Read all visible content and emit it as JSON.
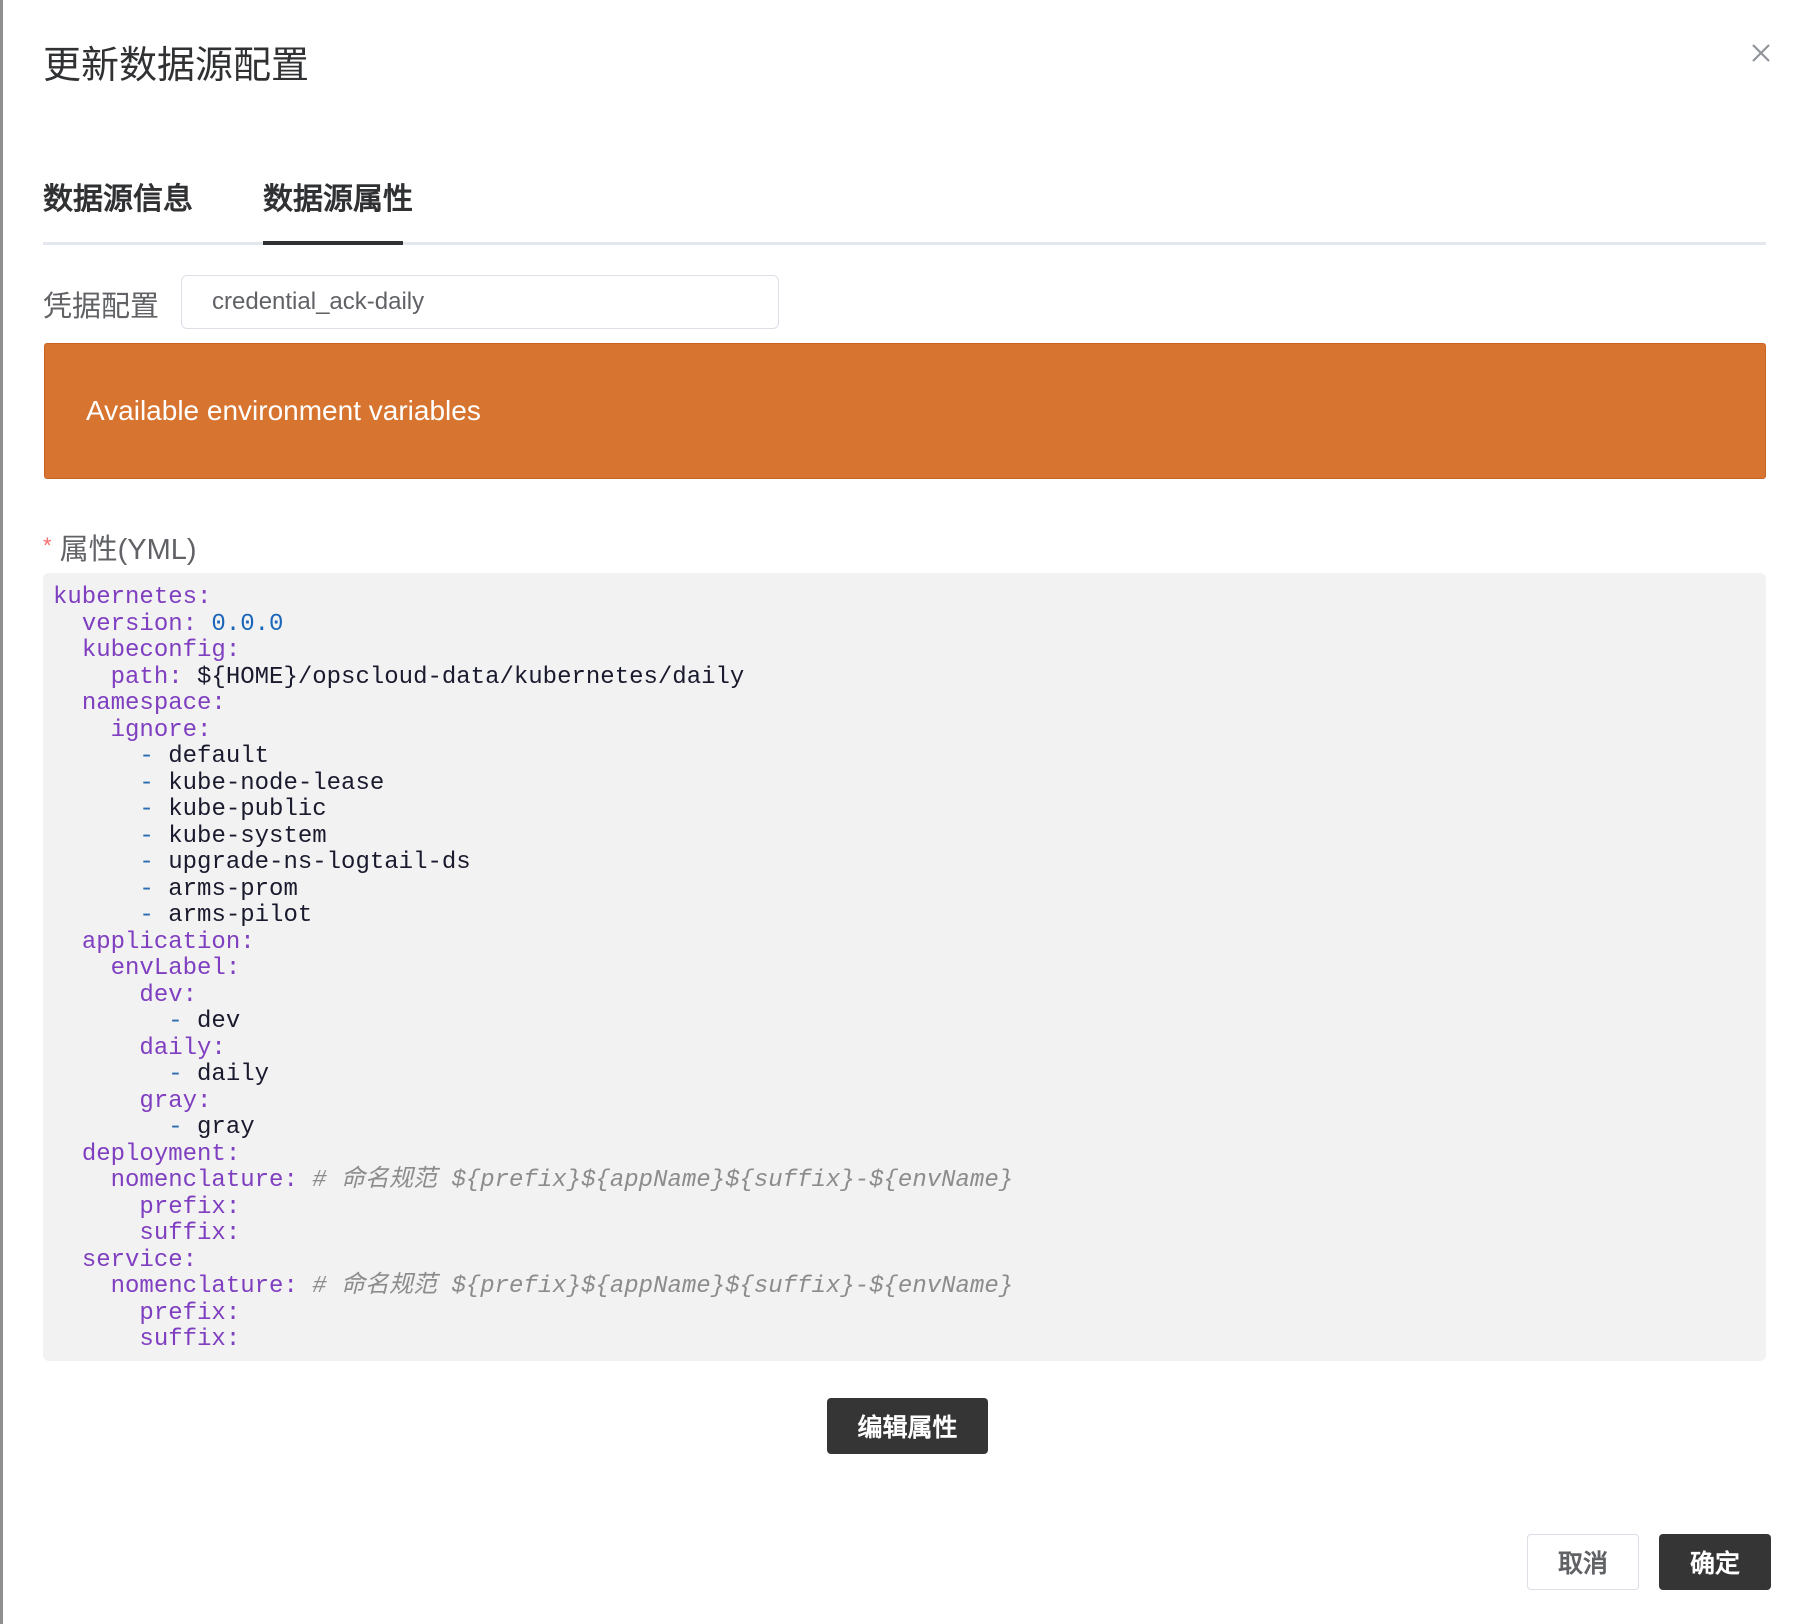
{
  "dialog": {
    "title": "更新数据源配置",
    "close_icon": "close-icon"
  },
  "tabs": [
    {
      "label": "数据源信息",
      "active": false
    },
    {
      "label": "数据源属性",
      "active": true
    }
  ],
  "credential": {
    "label": "凭据配置",
    "value": "credential_ack-daily"
  },
  "env_banner": {
    "text": "Available environment variables",
    "color": "#d67430"
  },
  "properties": {
    "required_mark": "*",
    "label": "属性(YML)",
    "yaml_lines": [
      [
        [
          "k",
          "kubernetes:"
        ]
      ],
      [
        [
          "",
          "  "
        ],
        [
          "k",
          "version:"
        ],
        [
          "",
          ""
        ],
        [
          "n",
          " 0.0.0"
        ]
      ],
      [
        [
          "",
          "  "
        ],
        [
          "k",
          "kubeconfig:"
        ]
      ],
      [
        [
          "",
          "    "
        ],
        [
          "k",
          "path:"
        ],
        [
          "v",
          " ${HOME}/opscloud-data/kubernetes/daily"
        ]
      ],
      [
        [
          "",
          "  "
        ],
        [
          "k",
          "namespace:"
        ]
      ],
      [
        [
          "",
          "    "
        ],
        [
          "k",
          "ignore:"
        ]
      ],
      [
        [
          "",
          "      "
        ],
        [
          "d",
          "-"
        ],
        [
          "v",
          " default"
        ]
      ],
      [
        [
          "",
          "      "
        ],
        [
          "d",
          "-"
        ],
        [
          "v",
          " kube-node-lease"
        ]
      ],
      [
        [
          "",
          "      "
        ],
        [
          "d",
          "-"
        ],
        [
          "v",
          " kube-public"
        ]
      ],
      [
        [
          "",
          "      "
        ],
        [
          "d",
          "-"
        ],
        [
          "v",
          " kube-system"
        ]
      ],
      [
        [
          "",
          "      "
        ],
        [
          "d",
          "-"
        ],
        [
          "v",
          " upgrade-ns-logtail-ds"
        ]
      ],
      [
        [
          "",
          "      "
        ],
        [
          "d",
          "-"
        ],
        [
          "v",
          " arms-prom"
        ]
      ],
      [
        [
          "",
          "      "
        ],
        [
          "d",
          "-"
        ],
        [
          "v",
          " arms-pilot"
        ]
      ],
      [
        [
          "",
          "  "
        ],
        [
          "k",
          "application:"
        ]
      ],
      [
        [
          "",
          "    "
        ],
        [
          "k",
          "envLabel:"
        ]
      ],
      [
        [
          "",
          "      "
        ],
        [
          "k",
          "dev:"
        ]
      ],
      [
        [
          "",
          "        "
        ],
        [
          "d",
          "-"
        ],
        [
          "v",
          " dev"
        ]
      ],
      [
        [
          "",
          "      "
        ],
        [
          "k",
          "daily:"
        ]
      ],
      [
        [
          "",
          "        "
        ],
        [
          "d",
          "-"
        ],
        [
          "v",
          " daily"
        ]
      ],
      [
        [
          "",
          "      "
        ],
        [
          "k",
          "gray:"
        ]
      ],
      [
        [
          "",
          "        "
        ],
        [
          "d",
          "-"
        ],
        [
          "v",
          " gray"
        ]
      ],
      [
        [
          "",
          "  "
        ],
        [
          "k",
          "deployment:"
        ]
      ],
      [
        [
          "",
          "    "
        ],
        [
          "k",
          "nomenclature:"
        ],
        [
          "c",
          " # 命名规范 ${prefix}${appName}${suffix}-${envName}"
        ]
      ],
      [
        [
          "",
          "      "
        ],
        [
          "k",
          "prefix:"
        ]
      ],
      [
        [
          "",
          "      "
        ],
        [
          "k",
          "suffix:"
        ]
      ],
      [
        [
          "",
          "  "
        ],
        [
          "k",
          "service:"
        ]
      ],
      [
        [
          "",
          "    "
        ],
        [
          "k",
          "nomenclature:"
        ],
        [
          "c",
          " # 命名规范 ${prefix}${appName}${suffix}-${envName}"
        ]
      ],
      [
        [
          "",
          "      "
        ],
        [
          "k",
          "prefix:"
        ]
      ],
      [
        [
          "",
          "      "
        ],
        [
          "k",
          "suffix:"
        ]
      ]
    ]
  },
  "buttons": {
    "edit_label": "编辑属性",
    "cancel_label": "取消",
    "ok_label": "确定"
  },
  "colors": {
    "yaml_key": "#7f3fc0",
    "yaml_number": "#1a66b8",
    "yaml_comment": "#8c8c8c",
    "primary_button": "#353535"
  }
}
